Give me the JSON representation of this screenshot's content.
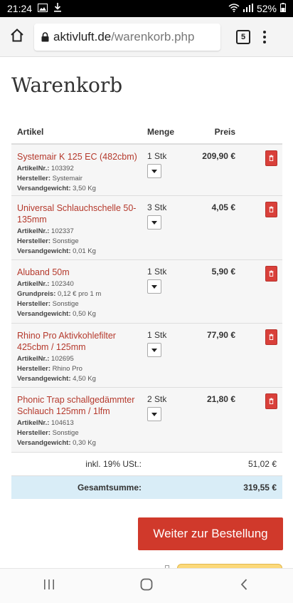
{
  "status_bar": {
    "time": "21:24",
    "battery": "52%"
  },
  "browser": {
    "url_domain": "aktivluft.de",
    "url_path": "/warenkorb.php",
    "tab_count": "5"
  },
  "page": {
    "title": "Warenkorb"
  },
  "cart": {
    "headers": {
      "article": "Artikel",
      "quantity": "Menge",
      "price": "Preis"
    },
    "items": [
      {
        "name": "Systemair K 125 EC (482cbm)",
        "meta": [
          {
            "label": "ArtikelNr.:",
            "value": "103392"
          },
          {
            "label": "Hersteller:",
            "value": "Systemair"
          },
          {
            "label": "Versandgewicht:",
            "value": "3,50 Kg"
          }
        ],
        "quantity": "1 Stk",
        "price": "209,90 €"
      },
      {
        "name": "Universal Schlauchschelle 50-135mm",
        "meta": [
          {
            "label": "ArtikelNr.:",
            "value": "102337"
          },
          {
            "label": "Hersteller:",
            "value": "Sonstige"
          },
          {
            "label": "Versandgewicht:",
            "value": "0,01 Kg"
          }
        ],
        "quantity": "3 Stk",
        "price": "4,05 €"
      },
      {
        "name": "Aluband 50m",
        "meta": [
          {
            "label": "ArtikelNr.:",
            "value": "102340"
          },
          {
            "label": "Grundpreis:",
            "value": "0,12 € pro 1 m"
          },
          {
            "label": "Hersteller:",
            "value": "Sonstige"
          },
          {
            "label": "Versandgewicht:",
            "value": "0,50 Kg"
          }
        ],
        "quantity": "1 Stk",
        "price": "5,90 €"
      },
      {
        "name": "Rhino Pro Aktivkohlefilter 425cbm / 125mm",
        "meta": [
          {
            "label": "ArtikelNr.:",
            "value": "102695"
          },
          {
            "label": "Hersteller:",
            "value": "Rhino Pro"
          },
          {
            "label": "Versandgewicht:",
            "value": "4,50 Kg"
          }
        ],
        "quantity": "1 Stk",
        "price": "77,90 €"
      },
      {
        "name": "Phonic Trap schallgedämmter Schlauch 125mm / 1lfm",
        "meta": [
          {
            "label": "ArtikelNr.:",
            "value": "104613"
          },
          {
            "label": "Hersteller:",
            "value": "Sonstige"
          },
          {
            "label": "Versandgewicht:",
            "value": "0,30 Kg"
          }
        ],
        "quantity": "2 Stk",
        "price": "21,80 €"
      }
    ],
    "tax_label": "inkl. 19% USt.:",
    "tax_value": "51,02 €",
    "total_label": "Gesamtsumme:",
    "total_value": "319,55 €"
  },
  "actions": {
    "checkout_label": "Weiter zur Bestellung"
  },
  "colors": {
    "accent_red": "#d0392b",
    "link_red": "#b5392c",
    "total_bg": "#d9edf7"
  }
}
